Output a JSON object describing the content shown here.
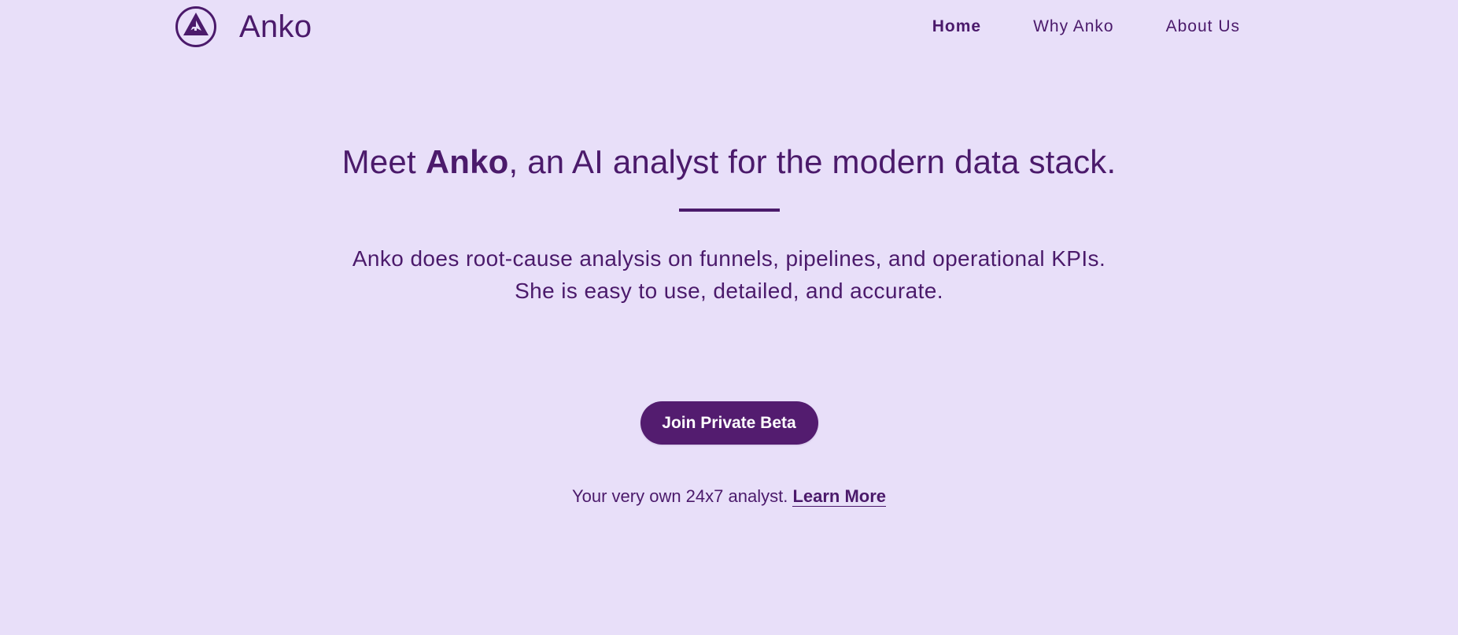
{
  "brand": {
    "name": "Anko",
    "logo_icon": "triangle-circle-logo-icon"
  },
  "nav": {
    "items": [
      {
        "label": "Home",
        "active": true
      },
      {
        "label": "Why Anko",
        "active": false
      },
      {
        "label": "About Us",
        "active": false
      }
    ]
  },
  "hero": {
    "headline_prefix": "Meet ",
    "headline_brand": "Anko",
    "headline_suffix": ", an AI analyst for the modern data stack.",
    "description_line_1": "Anko does root-cause analysis on funnels, pipelines, and operational KPIs.",
    "description_line_2": "She is easy to use, detailed, and accurate."
  },
  "cta": {
    "button_label": "Join Private Beta",
    "tagline": "Your very own 24x7 analyst. ",
    "learn_more_label": "Learn More"
  },
  "colors": {
    "background": "#e8dff9",
    "primary": "#4b1a6b",
    "button": "#531c6f",
    "button_text": "#ffffff"
  }
}
